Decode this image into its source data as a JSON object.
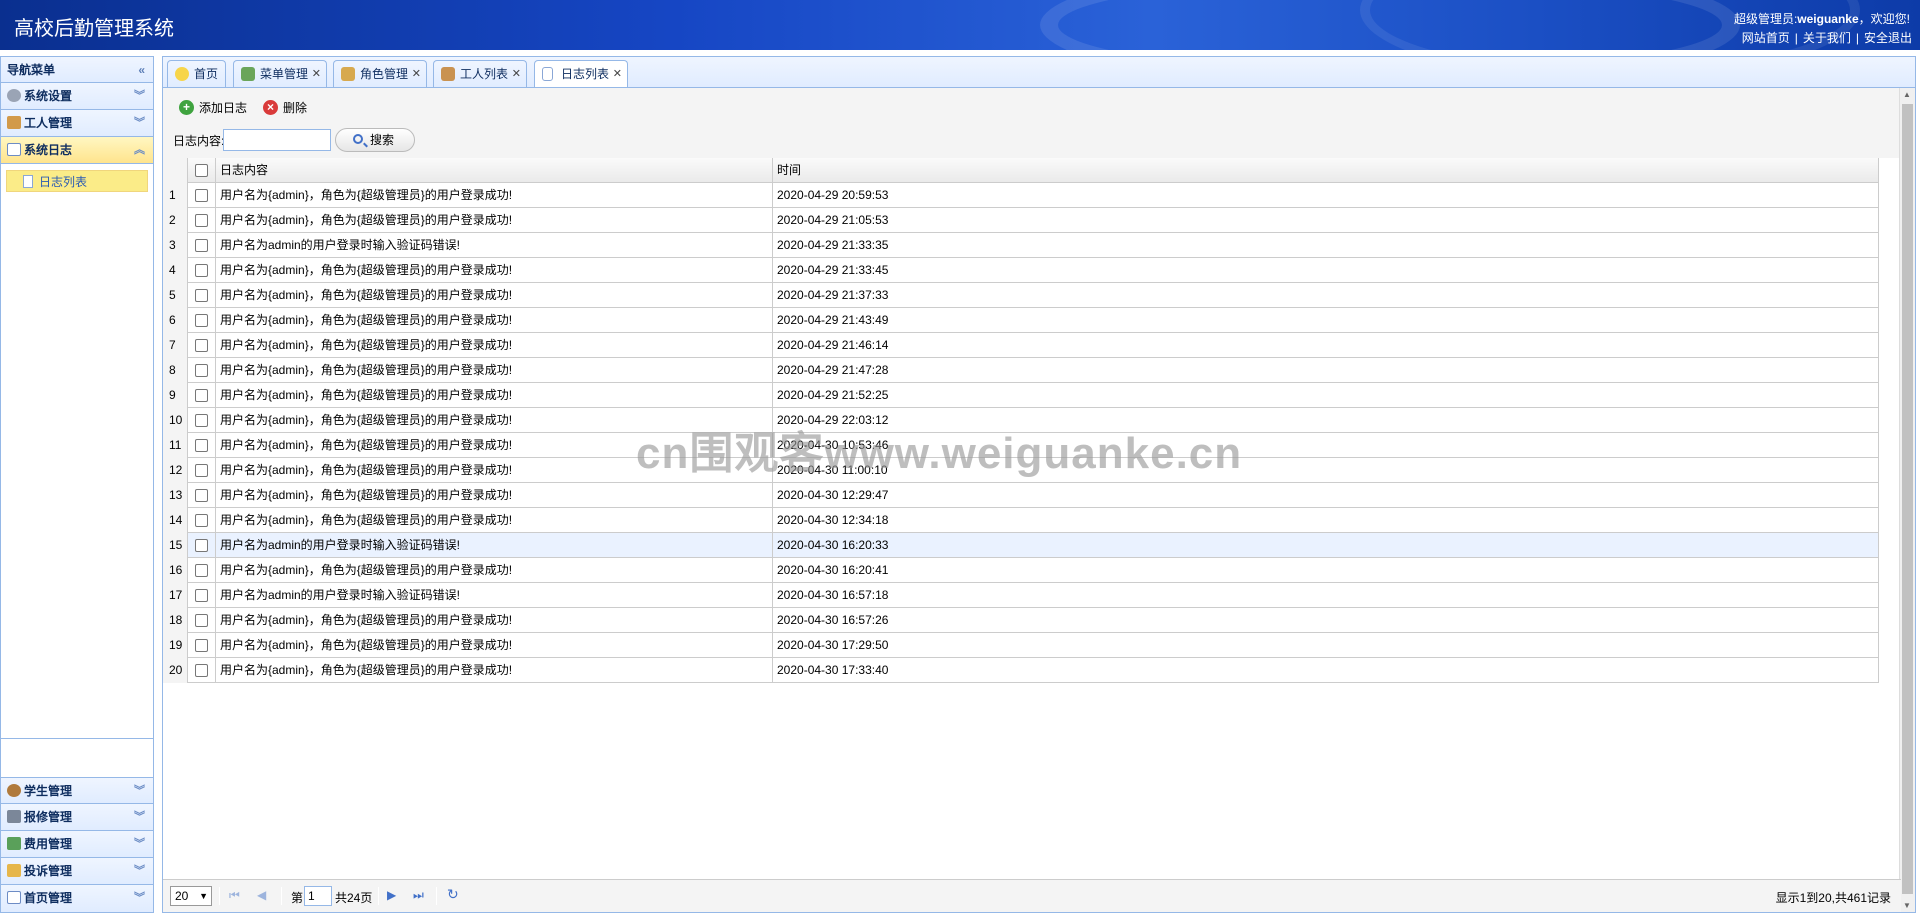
{
  "header": {
    "title": "高校后勤管理系统",
    "user_prefix": "超级管理员:",
    "user_name": "weiguanke",
    "user_suffix": "，欢迎您!",
    "links": [
      "网站首页",
      "关于我们",
      "安全退出"
    ]
  },
  "sidebar": {
    "title": "导航菜单",
    "top_items": [
      {
        "label": "系统设置",
        "icon": "gear-icon"
      },
      {
        "label": "工人管理",
        "icon": "users-icon"
      },
      {
        "label": "系统日志",
        "icon": "calendar-icon"
      }
    ],
    "sub_item": "日志列表",
    "bottom_items": [
      {
        "label": "学生管理",
        "icon": "student-icon"
      },
      {
        "label": "报修管理",
        "icon": "tools-icon"
      },
      {
        "label": "费用管理",
        "icon": "money-icon"
      },
      {
        "label": "投诉管理",
        "icon": "folder-icon"
      },
      {
        "label": "首页管理",
        "icon": "layout-icon"
      }
    ]
  },
  "tabs": [
    {
      "label": "首页",
      "icon": "bulb-icon",
      "closable": false
    },
    {
      "label": "菜单管理",
      "icon": "tree-icon",
      "closable": true
    },
    {
      "label": "角色管理",
      "icon": "roles-icon",
      "closable": true
    },
    {
      "label": "工人列表",
      "icon": "users-icon",
      "closable": true
    },
    {
      "label": "日志列表",
      "icon": "doc-icon",
      "closable": true
    }
  ],
  "toolbar": {
    "add_label": "添加日志",
    "delete_label": "删除",
    "search_label": "日志内容:",
    "search_value": "",
    "search_button": "搜索"
  },
  "grid": {
    "columns": [
      "日志内容",
      "时间"
    ],
    "rows": [
      {
        "n": "1",
        "msg": "用户名为{admin}，角色为{超级管理员}的用户登录成功!",
        "time": "2020-04-29 20:59:53"
      },
      {
        "n": "2",
        "msg": "用户名为{admin}，角色为{超级管理员}的用户登录成功!",
        "time": "2020-04-29 21:05:53"
      },
      {
        "n": "3",
        "msg": "用户名为admin的用户登录时输入验证码错误!",
        "time": "2020-04-29 21:33:35"
      },
      {
        "n": "4",
        "msg": "用户名为{admin}，角色为{超级管理员}的用户登录成功!",
        "time": "2020-04-29 21:33:45"
      },
      {
        "n": "5",
        "msg": "用户名为{admin}，角色为{超级管理员}的用户登录成功!",
        "time": "2020-04-29 21:37:33"
      },
      {
        "n": "6",
        "msg": "用户名为{admin}，角色为{超级管理员}的用户登录成功!",
        "time": "2020-04-29 21:43:49"
      },
      {
        "n": "7",
        "msg": "用户名为{admin}，角色为{超级管理员}的用户登录成功!",
        "time": "2020-04-29 21:46:14"
      },
      {
        "n": "8",
        "msg": "用户名为{admin}，角色为{超级管理员}的用户登录成功!",
        "time": "2020-04-29 21:47:28"
      },
      {
        "n": "9",
        "msg": "用户名为{admin}，角色为{超级管理员}的用户登录成功!",
        "time": "2020-04-29 21:52:25"
      },
      {
        "n": "10",
        "msg": "用户名为{admin}，角色为{超级管理员}的用户登录成功!",
        "time": "2020-04-29 22:03:12"
      },
      {
        "n": "11",
        "msg": "用户名为{admin}，角色为{超级管理员}的用户登录成功!",
        "time": "2020-04-30 10:53:46"
      },
      {
        "n": "12",
        "msg": "用户名为{admin}，角色为{超级管理员}的用户登录成功!",
        "time": "2020-04-30 11:00:10"
      },
      {
        "n": "13",
        "msg": "用户名为{admin}，角色为{超级管理员}的用户登录成功!",
        "time": "2020-04-30 12:29:47"
      },
      {
        "n": "14",
        "msg": "用户名为{admin}，角色为{超级管理员}的用户登录成功!",
        "time": "2020-04-30 12:34:18"
      },
      {
        "n": "15",
        "msg": "用户名为admin的用户登录时输入验证码错误!",
        "time": "2020-04-30 16:20:33"
      },
      {
        "n": "16",
        "msg": "用户名为{admin}，角色为{超级管理员}的用户登录成功!",
        "time": "2020-04-30 16:20:41"
      },
      {
        "n": "17",
        "msg": "用户名为admin的用户登录时输入验证码错误!",
        "time": "2020-04-30 16:57:18"
      },
      {
        "n": "18",
        "msg": "用户名为{admin}，角色为{超级管理员}的用户登录成功!",
        "time": "2020-04-30 16:57:26"
      },
      {
        "n": "19",
        "msg": "用户名为{admin}，角色为{超级管理员}的用户登录成功!",
        "time": "2020-04-30 17:29:50"
      },
      {
        "n": "20",
        "msg": "用户名为{admin}，角色为{超级管理员}的用户登录成功!",
        "time": "2020-04-30 17:33:40"
      }
    ],
    "highlighted_row": 15
  },
  "pager": {
    "page_size": "20",
    "page_prefix": "第",
    "page_value": "1",
    "total_pages": "共24页",
    "info": "显示1到20,共461记录"
  },
  "watermark": "cn围观客www.weiguanke.cn",
  "colors": {
    "header_blue": "#1646c4",
    "border_blue": "#95b8e7",
    "active_yellow": "#ffe48d",
    "row_highlight": "#eaf2ff"
  }
}
